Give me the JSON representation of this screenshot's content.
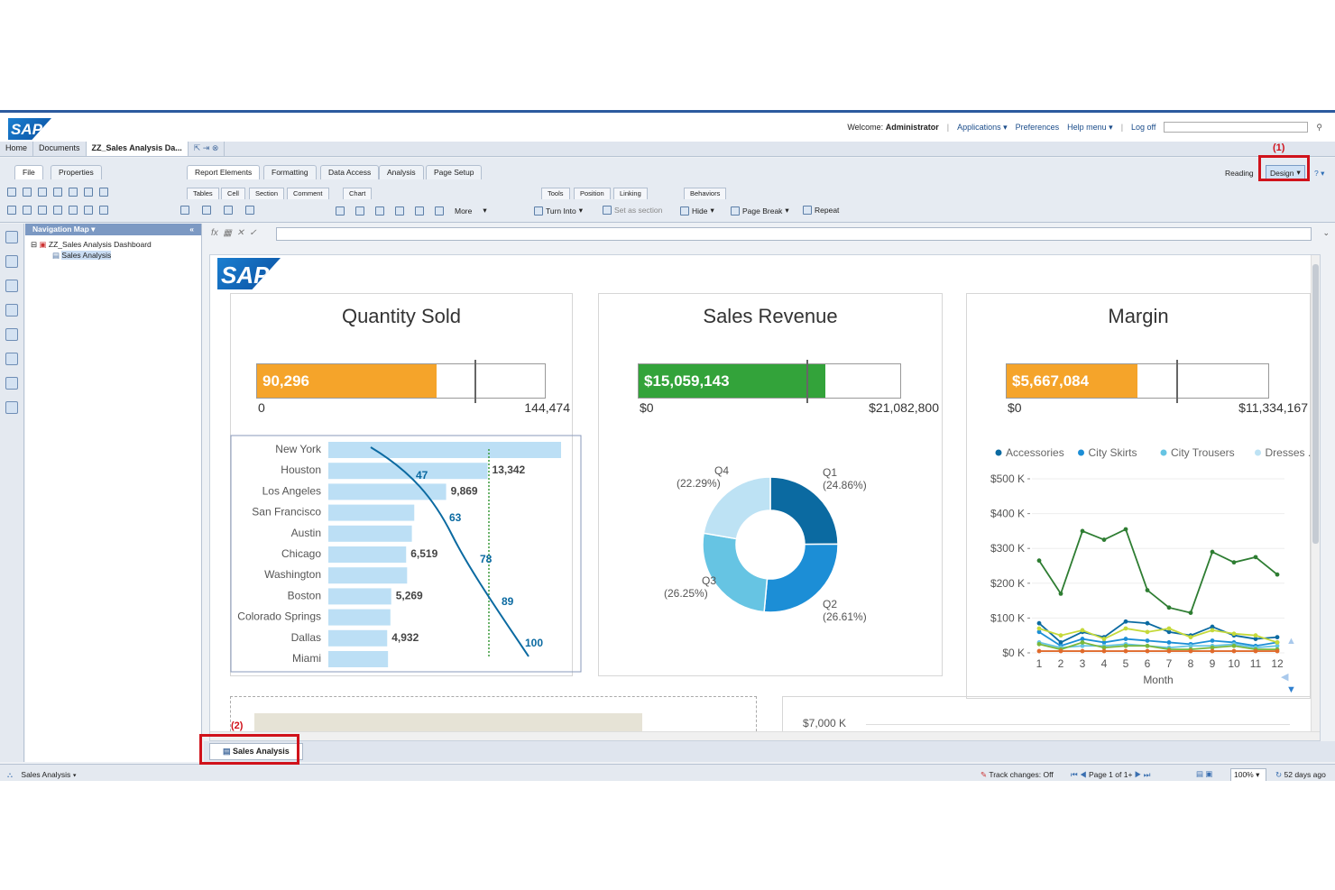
{
  "header": {
    "logo": "SAP",
    "welcome_prefix": "Welcome:",
    "user": "Administrator",
    "links": [
      "Applications ▾",
      "Preferences",
      "Help menu ▾",
      "Log off"
    ]
  },
  "tabs": [
    "Home",
    "Documents",
    "ZZ_Sales Analysis Da..."
  ],
  "ribbon": {
    "left_tabs": [
      "File",
      "Properties"
    ],
    "main_tabs": [
      "Report Elements",
      "Formatting",
      "Data Access",
      "Analysis",
      "Page Setup"
    ],
    "sub_tabs": [
      "Tables",
      "Cell",
      "Section",
      "Comment",
      "Chart",
      "Tools",
      "Position",
      "Linking",
      "Behaviors"
    ],
    "tools": [
      "More",
      "Turn Into",
      "Set as section",
      "Hide",
      "Page Break",
      "Repeat"
    ],
    "mode_reading": "Reading",
    "mode_design": "Design"
  },
  "callouts": [
    "(1)",
    "(2)"
  ],
  "nav": {
    "title": "Navigation Map",
    "root": "ZZ_Sales Analysis Dashboard",
    "child": "Sales Analysis"
  },
  "canvas": {
    "logo": "SAP"
  },
  "quantity": {
    "title": "Quantity Sold",
    "value": "90,296",
    "min": "0",
    "max": "144,474",
    "fill": 0.625,
    "target": 0.755
  },
  "revenue": {
    "title": "Sales Revenue",
    "value": "$15,059,143",
    "min": "$0",
    "max": "$21,082,800",
    "fill": 0.714,
    "target": 0.64
  },
  "margin": {
    "title": "Margin",
    "value": "$5,667,084",
    "min": "$0",
    "max": "$11,334,167",
    "fill": 0.5,
    "target": 0.648
  },
  "colors": {
    "orange": "#f5a42a",
    "green": "#33a33a",
    "bar": "#bcdff5",
    "blue_dark": "#0b6aa1"
  },
  "bar_chart": {
    "type": "bar",
    "categories": [
      "New York",
      "Houston",
      "Los Angeles",
      "San Francisco",
      "Austin",
      "Chicago",
      "Washington",
      "Boston",
      "Colorado Springs",
      "Dallas",
      "Miami"
    ],
    "values": [
      19500,
      13342,
      9869,
      7200,
      7000,
      6519,
      6600,
      5269,
      5200,
      4932,
      5000
    ],
    "labels": [
      "",
      "13,342",
      "9,869",
      "",
      "",
      "6,519",
      "",
      "5,269",
      "",
      "4,932",
      ""
    ],
    "cumulative_pct_labels": [
      "47",
      "63",
      "78",
      "89",
      "100"
    ]
  },
  "donut": {
    "type": "pie",
    "slices": [
      {
        "label": "Q1",
        "pct_label": "(24.86%)",
        "value": 24.86,
        "color": "#0b6aa1"
      },
      {
        "label": "Q2",
        "pct_label": "(26.61%)",
        "value": 26.61,
        "color": "#1c8ed6"
      },
      {
        "label": "Q3",
        "pct_label": "(26.25%)",
        "value": 26.25,
        "color": "#66c4e3"
      },
      {
        "label": "Q4",
        "pct_label": "(22.29%)",
        "value": 22.29,
        "color": "#bde2f4"
      }
    ]
  },
  "chart_data": {
    "type": "line",
    "x": [
      1,
      2,
      3,
      4,
      5,
      6,
      7,
      8,
      9,
      10,
      11,
      12
    ],
    "xlabel": "Month",
    "yticks": [
      "$0 K",
      "$100 K",
      "$200 K",
      "$300 K",
      "$400 K",
      "$500 K"
    ],
    "ylim": [
      0,
      500
    ],
    "legend": [
      "Accessories",
      "City Skirts",
      "City Trousers",
      "Dresses ..."
    ],
    "series": [
      {
        "name": "",
        "color": "#2e7d32",
        "values": [
          265,
          170,
          350,
          325,
          355,
          180,
          130,
          115,
          290,
          260,
          275,
          225
        ]
      },
      {
        "name": "Accessories",
        "color": "#0b6aa1",
        "values": [
          85,
          30,
          60,
          45,
          90,
          85,
          60,
          50,
          75,
          50,
          40,
          45
        ]
      },
      {
        "name": "City Skirts",
        "color": "#1c8ed6",
        "values": [
          60,
          20,
          40,
          30,
          40,
          35,
          30,
          25,
          35,
          30,
          20,
          30
        ]
      },
      {
        "name": "City Trousers",
        "color": "#66c4e3",
        "values": [
          30,
          15,
          20,
          20,
          25,
          20,
          15,
          20,
          20,
          25,
          15,
          20
        ]
      },
      {
        "name": "",
        "color": "#c5d93a",
        "values": [
          70,
          50,
          65,
          40,
          70,
          60,
          70,
          45,
          65,
          55,
          50,
          30
        ]
      },
      {
        "name": "",
        "color": "#7ab83b",
        "values": [
          25,
          10,
          30,
          15,
          20,
          20,
          10,
          10,
          15,
          20,
          10,
          10
        ]
      },
      {
        "name": "",
        "color": "#e06a2b",
        "values": [
          5,
          5,
          5,
          5,
          5,
          5,
          5,
          5,
          5,
          5,
          5,
          5
        ]
      }
    ]
  },
  "lower_chart": {
    "tick": "$7,000 K"
  },
  "report_tab": "Sales Analysis",
  "status": {
    "left": "Sales Analysis ▾",
    "track": "Track changes: Off",
    "page": "Page 1 of 1+",
    "zoom": "100%",
    "ago": "52 days ago"
  }
}
